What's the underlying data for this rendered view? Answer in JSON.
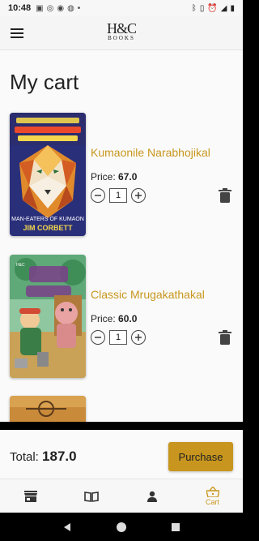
{
  "status": {
    "time": "10:48"
  },
  "app": {
    "logo_mark": "H&C",
    "logo_sub": "BOOKS"
  },
  "page": {
    "title": "My cart"
  },
  "cart": {
    "price_label": "Price:",
    "items": [
      {
        "name": "Kumaonile Narabhojikal",
        "price": "67.0",
        "qty": "1",
        "cover_subtitle": "MAN-EATERS OF KUMAON",
        "cover_author": "JIM CORBETT"
      },
      {
        "name": "Classic Mrugakathakal",
        "price": "60.0",
        "qty": "1"
      }
    ]
  },
  "footer": {
    "total_label": "Total:",
    "total_value": "187.0",
    "purchase_label": "Purchase"
  },
  "nav": {
    "cart_label": "Cart"
  },
  "colors": {
    "accent": "#c8961e"
  }
}
